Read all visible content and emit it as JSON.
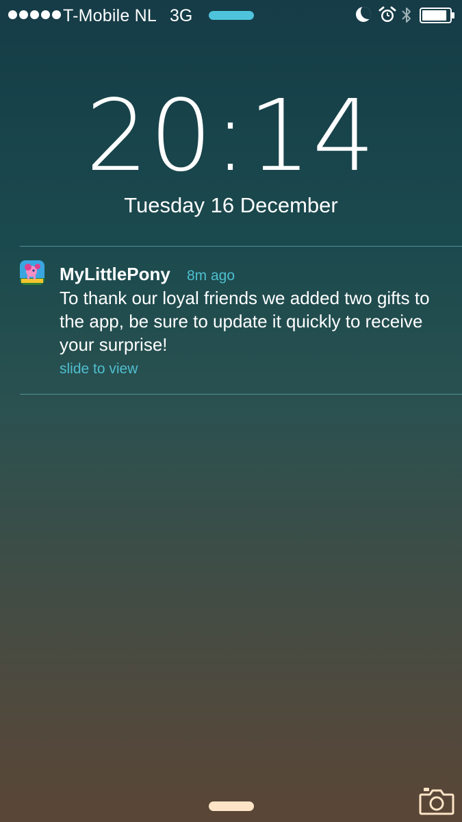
{
  "status_bar": {
    "signal_bars": 5,
    "carrier": "T-Mobile NL",
    "network": "3G",
    "icons": [
      "moon-icon",
      "alarm-clock-icon",
      "bluetooth-icon",
      "battery-icon"
    ],
    "battery_level": 0.9,
    "loading_color": "#4fc3dc"
  },
  "lock_screen": {
    "time": "20:14",
    "date": "Tuesday 16 December"
  },
  "notification": {
    "app_name": "MyLittlePony",
    "time_ago": "8m ago",
    "message": "To thank our loyal friends we added two gifts to the app, be sure to update it quickly to receive your surprise!",
    "hint": "slide to view",
    "accent_color": "#4fbfcf"
  },
  "bottom": {
    "icons": [
      "home-indicator",
      "camera-icon"
    ],
    "accent_color": "#fde4c6"
  }
}
